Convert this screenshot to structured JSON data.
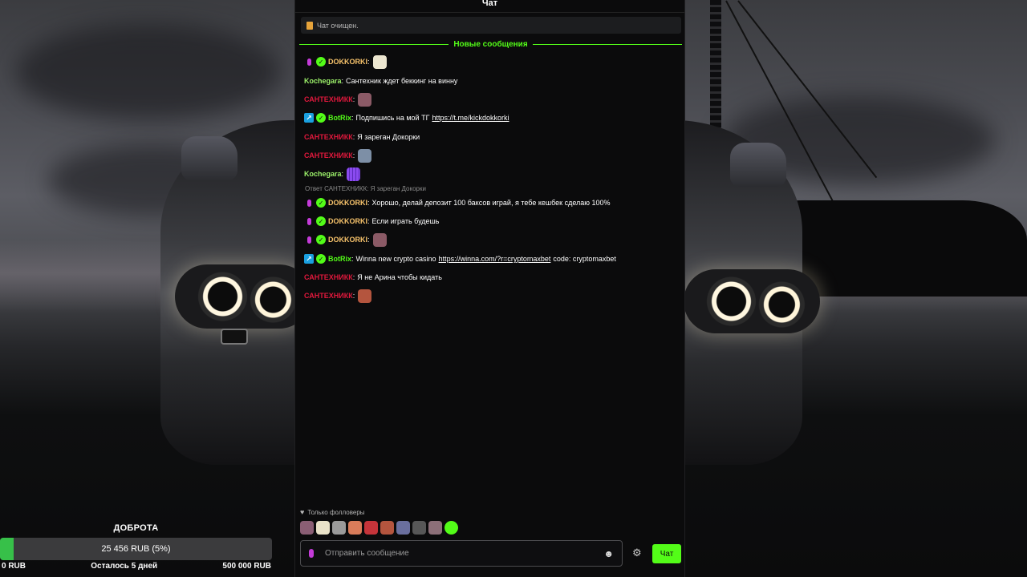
{
  "chat": {
    "title": "Чат",
    "cleared_notice": "Чат очищен.",
    "new_messages_divider": "Новые сообщения",
    "messages": [
      {
        "user": "DOKKORKI",
        "color": "#f7c36b",
        "badges": [
          "mic",
          "verified"
        ],
        "text": "",
        "emote": "duck-emote"
      },
      {
        "user": "Kochegara",
        "color": "#9cf06a",
        "badges": [],
        "text": "Сантехник ждет беккинг на винну"
      },
      {
        "user": "САНТЕХНИКК",
        "color": "#e0183c",
        "badges": [],
        "text": "",
        "emote": "face-emote"
      },
      {
        "user": "BotRix",
        "color": "#53fc18",
        "badges": [
          "bot",
          "verified"
        ],
        "text": "Подпишись на мой ТГ",
        "link": "https://t.me/kickdokkorki"
      },
      {
        "user": "САНТЕХНИКК",
        "color": "#e0183c",
        "badges": [],
        "text": "Я зареган Докорки"
      },
      {
        "user": "САНТЕХНИКК",
        "color": "#e0183c",
        "badges": [],
        "text": "",
        "emote": "figure-emote"
      },
      {
        "user": "Kochegara",
        "color": "#9cf06a",
        "badges": [],
        "text": "",
        "emote": "grid-emote"
      },
      {
        "reply_to": "Ответ САНТЕХНИКК: Я зареган Докорки"
      },
      {
        "user": "DOKKORKI",
        "color": "#f7c36b",
        "badges": [
          "mic",
          "verified"
        ],
        "text": "Хорошо, делай депозит 100 баксов играй, я тебе кешбек сделаю 100%"
      },
      {
        "user": "DOKKORKI",
        "color": "#f7c36b",
        "badges": [
          "mic",
          "verified"
        ],
        "text": "Если играть будешь"
      },
      {
        "user": "DOKKORKI",
        "color": "#f7c36b",
        "badges": [
          "mic",
          "verified"
        ],
        "text": "",
        "emote": "face-emote"
      },
      {
        "user": "BotRix",
        "color": "#53fc18",
        "badges": [
          "bot",
          "verified"
        ],
        "text": "Winna new crypto casino",
        "link": "https://winna.com/?r=cryptomaxbet",
        "text_after": "code: cryptomaxbet"
      },
      {
        "user": "САНТЕХНИКК",
        "color": "#e0183c",
        "badges": [],
        "text": "Я не Арина чтобы кидать"
      },
      {
        "user": "САНТЕХНИКК",
        "color": "#e0183c",
        "badges": [],
        "text": "",
        "emote": "mouth-emote"
      }
    ],
    "followers_only": "Только фолловеры",
    "input_placeholder": "Отправить сообщение",
    "send_label": "Чат"
  },
  "goal": {
    "title": "ДОБРОТА",
    "bar_label": "25 456  RUB  (5%)",
    "progress_fraction": 0.05,
    "min_label": "0  RUB",
    "remaining_label": "Осталось 5 дней",
    "max_label": "500 000  RUB",
    "accent": "#37c049"
  }
}
